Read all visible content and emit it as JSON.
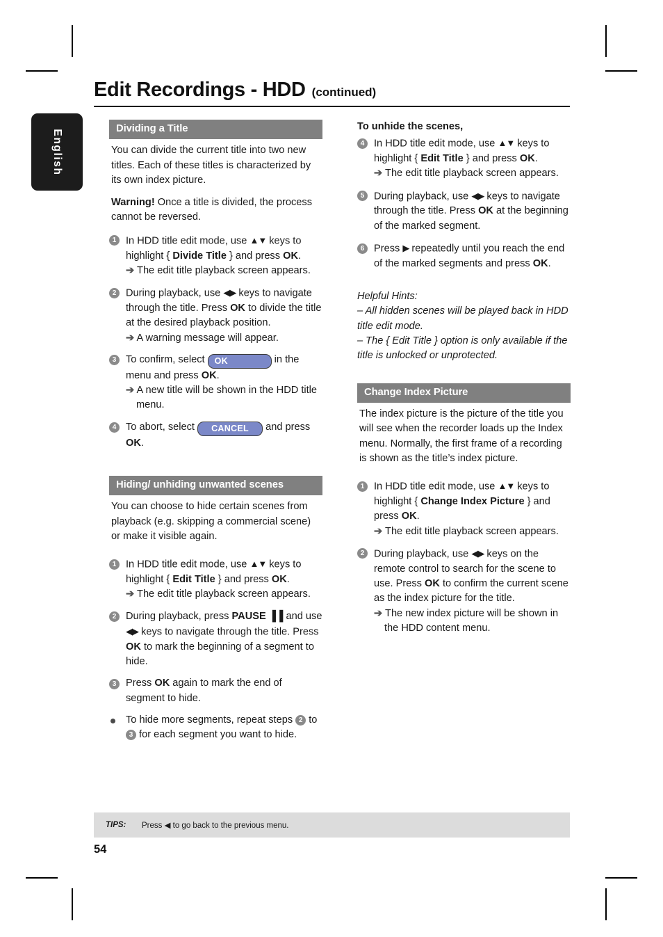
{
  "language_tab": {
    "label": "English"
  },
  "header": {
    "title": "Edit Recordings - HDD",
    "subtitle": "(continued)"
  },
  "left_column": {
    "section1": {
      "heading": "Dividing a Title",
      "intro": "You can divide the current title into two new titles. Each of these titles is characterized by its own index picture.",
      "warning_label": "Warning!",
      "warning_text": " Once a title is divided, the process cannot be reversed.",
      "steps": [
        {
          "num": "1",
          "text_a": "In HDD title edit mode, use ",
          "keys": "▲▼",
          "text_b": " keys to highlight { ",
          "bold": "Divide Title",
          "text_c": " } and press ",
          "bold2": "OK",
          "text_d": ".",
          "result": "The edit title playback screen appears."
        },
        {
          "num": "2",
          "text_a": "During playback, use ",
          "keys": "◀▶",
          "text_b": " keys to navigate through the title. Press ",
          "bold": "OK",
          "text_c": " to divide the title at the desired playback position.",
          "result": "A warning message will appear."
        },
        {
          "num": "3",
          "text_a": "To confirm, select ",
          "button": "OK",
          "text_b": " in the menu and press ",
          "bold": "OK",
          "text_c": ".",
          "result": "A new title will be shown in the HDD title menu."
        },
        {
          "num": "4",
          "text_a": "To abort, select ",
          "button": "CANCEL",
          "text_b": " and press ",
          "bold": "OK",
          "text_c": "."
        }
      ]
    },
    "section2": {
      "heading": "Hiding/ unhiding unwanted scenes",
      "intro": "You can choose to hide certain scenes from playback (e.g. skipping a commercial scene) or make it visible again.",
      "steps": [
        {
          "num": "1",
          "text_a": "In HDD title edit mode, use ",
          "keys": "▲▼",
          "text_b": " keys to highlight { ",
          "bold": "Edit Title",
          "text_c": " } and press ",
          "bold2": "OK",
          "text_d": ".",
          "result": "The edit title playback screen appears."
        },
        {
          "num": "2",
          "text_a": "During playback, press ",
          "bold": "PAUSE",
          "pause_glyph": "▐▐",
          "text_b": " and use ",
          "keys": "◀▶",
          "text_c": " keys to navigate through the title. Press ",
          "bold2": "OK",
          "text_d": " to mark the beginning of a segment to hide."
        },
        {
          "num": "3",
          "text_a": "Press ",
          "bold": "OK",
          "text_b": " again to mark the end of segment to hide."
        },
        {
          "num": "•",
          "text_a": "To hide more segments, repeat steps ",
          "inline_num1": "2",
          "text_b": " to ",
          "inline_num2": "3",
          "text_c": " for each segment you want to hide."
        }
      ]
    }
  },
  "right_column": {
    "unhide": {
      "heading": "To unhide the scenes,",
      "steps": [
        {
          "num": "4",
          "text_a": "In HDD title edit mode, use ",
          "keys": "▲▼",
          "text_b": " keys to highlight { ",
          "bold": "Edit Title",
          "text_c": " } and press ",
          "bold2": "OK",
          "text_d": ".",
          "result": "The edit title playback screen appears."
        },
        {
          "num": "5",
          "text_a": "During playback, use ",
          "keys": "◀▶",
          "text_b": " keys to navigate through the title. Press ",
          "bold": "OK",
          "text_c": " at the beginning of the marked segment."
        },
        {
          "num": "6",
          "text_a": "Press ",
          "keys": "▶",
          "text_b": " repeatedly until you reach the end of the marked segments and press ",
          "bold": "OK",
          "text_c": "."
        }
      ],
      "hints_title": "Helpful Hints:",
      "hint1": "–  All hidden scenes will be played back in HDD title edit mode.",
      "hint2": "–  The { Edit Title } option is only available if the title is unlocked or unprotected."
    },
    "section3": {
      "heading": "Change Index Picture",
      "intro": "The index picture is the picture of the title you will see when the recorder loads up the Index menu. Normally, the first frame of a recording is shown as the title’s index picture.",
      "steps": [
        {
          "num": "1",
          "text_a": "In HDD title edit mode, use ",
          "keys": "▲▼",
          "text_b": " keys to highlight { ",
          "bold": "Change Index Picture",
          "text_c": " } and press ",
          "bold2": "OK",
          "text_d": ".",
          "result": "The edit title playback screen appears."
        },
        {
          "num": "2",
          "text_a": "During playback, use ",
          "keys": "◀▶",
          "text_b": " keys on the remote control to search for the scene to use. Press ",
          "bold": "OK",
          "text_c": " to confirm the current scene as the index picture for the title.",
          "result": "The new index picture will be shown in the HDD content menu."
        }
      ]
    }
  },
  "footer": {
    "tips_label": "TIPS:",
    "tips_text_a": "Press ",
    "tips_glyph": "◀",
    "tips_text_b": " to go back to the previous menu.",
    "page_number": "54"
  },
  "glyphs": {
    "arrow_result": "➔"
  },
  "colors": {
    "section_bar": "#808080",
    "osd_button": "#7b88c8",
    "tab": "#1c1c1c",
    "tips_bar": "#dcdcdc"
  }
}
